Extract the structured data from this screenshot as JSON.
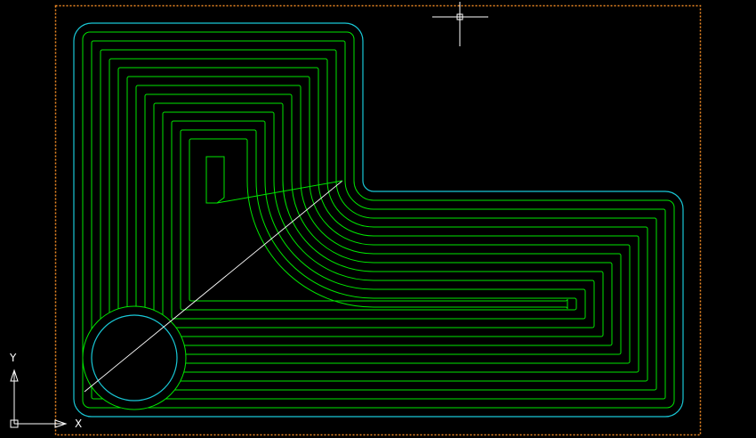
{
  "app": {
    "type": "cad-drawing-viewport"
  },
  "colors": {
    "background": "#000000",
    "sheet_border": "#f08a24",
    "outer_boundary": "#19c8d6",
    "toolpath": "#00e600",
    "linking_moves": "#ffffff",
    "crosshair": "#ffffff",
    "ucs_icon": "#ffffff"
  },
  "icons": {
    "ucs": "ucs-axis-icon",
    "cursor": "crosshair-cursor-icon"
  },
  "ucs": {
    "x_label": "X",
    "y_label": "Y"
  },
  "drawing": {
    "boundary_shape": "L-shaped pocket with rounded corners",
    "island_shape": "circle",
    "toolpath_pattern": "offset spiral",
    "toolpath_pass_count": 13
  }
}
